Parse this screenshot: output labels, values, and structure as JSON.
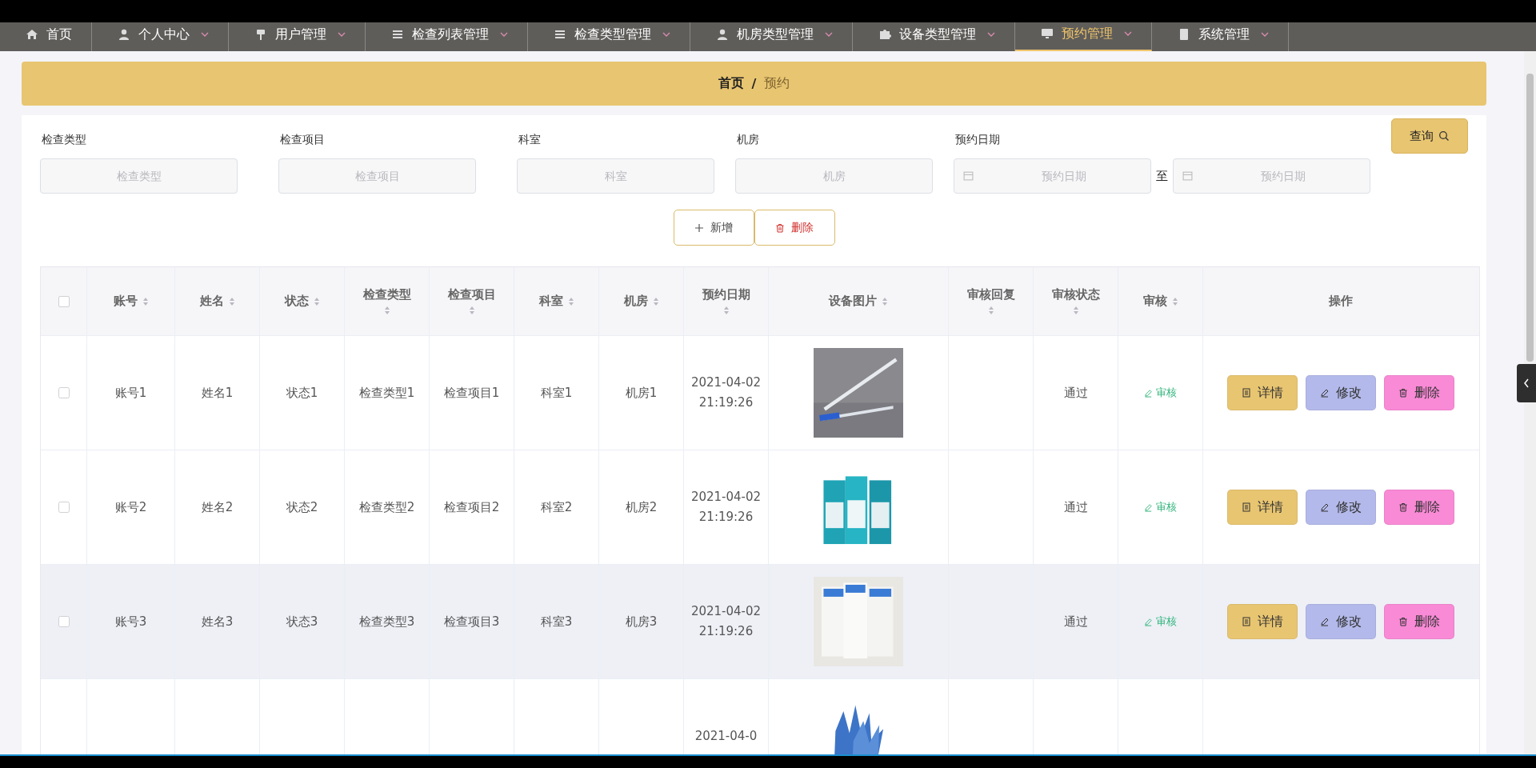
{
  "nav": [
    {
      "label": "首页",
      "selected": false,
      "dropdown": false
    },
    {
      "label": "个人中心",
      "selected": false,
      "dropdown": true
    },
    {
      "label": "用户管理",
      "selected": false,
      "dropdown": true
    },
    {
      "label": "检查列表管理",
      "selected": false,
      "dropdown": true
    },
    {
      "label": "检查类型管理",
      "selected": false,
      "dropdown": true
    },
    {
      "label": "机房类型管理",
      "selected": false,
      "dropdown": true
    },
    {
      "label": "设备类型管理",
      "selected": false,
      "dropdown": true
    },
    {
      "label": "预约管理",
      "selected": true,
      "dropdown": true
    },
    {
      "label": "系统管理",
      "selected": false,
      "dropdown": true
    }
  ],
  "breadcrumb": {
    "home": "首页",
    "separator": "/",
    "current": "预约"
  },
  "filters": [
    {
      "label": "检查类型",
      "placeholder": "检查类型"
    },
    {
      "label": "检查项目",
      "placeholder": "检查项目"
    },
    {
      "label": "科室",
      "placeholder": "科室"
    },
    {
      "label": "机房",
      "placeholder": "机房"
    }
  ],
  "date_filter": {
    "label": "预约日期",
    "start_placeholder": "预约日期",
    "to": "至",
    "end_placeholder": "预约日期"
  },
  "search_button": "查询",
  "add_button": "新增",
  "delete_button": "删除",
  "table": {
    "select_all_checked": false,
    "columns": [
      {
        "label": "账号",
        "sortable": true
      },
      {
        "label": "姓名",
        "sortable": true
      },
      {
        "label": "状态",
        "sortable": true
      },
      {
        "label": "检查类型",
        "sortable": true
      },
      {
        "label": "检查项目",
        "sortable": true
      },
      {
        "label": "科室",
        "sortable": true
      },
      {
        "label": "机房",
        "sortable": true
      },
      {
        "label": "预约日期",
        "sortable": true
      },
      {
        "label": "设备图片",
        "sortable": true
      },
      {
        "label": "审核回复",
        "sortable": true
      },
      {
        "label": "审核状态",
        "sortable": true
      },
      {
        "label": "审核",
        "sortable": true
      },
      {
        "label": "操作",
        "sortable": false
      }
    ],
    "rows": [
      {
        "checked": false,
        "hovered": false,
        "cells": [
          "账号1",
          "姓名1",
          "状态1",
          "检查类型1",
          "检查项目1",
          "科室1",
          "机房1"
        ],
        "date": "2021-04-02 21:19:26",
        "status": "通过",
        "review": "审核",
        "actions": [
          "详情",
          "修改",
          "删除"
        ]
      },
      {
        "checked": false,
        "hovered": false,
        "cells": [
          "账号2",
          "姓名2",
          "状态2",
          "检查类型2",
          "检查项目2",
          "科室2",
          "机房2"
        ],
        "date": "2021-04-02 21:19:26",
        "status": "通过",
        "review": "审核",
        "actions": [
          "详情",
          "修改",
          "删除"
        ]
      },
      {
        "checked": false,
        "hovered": true,
        "cells": [
          "账号3",
          "姓名3",
          "状态3",
          "检查类型3",
          "检查项目3",
          "科室3",
          "机房3"
        ],
        "date": "2021-04-02 21:19:26",
        "status": "通过",
        "review": "审核",
        "actions": [
          "详情",
          "修改",
          "删除"
        ]
      },
      {
        "hovered": false,
        "date": "2021-04-0"
      }
    ]
  }
}
